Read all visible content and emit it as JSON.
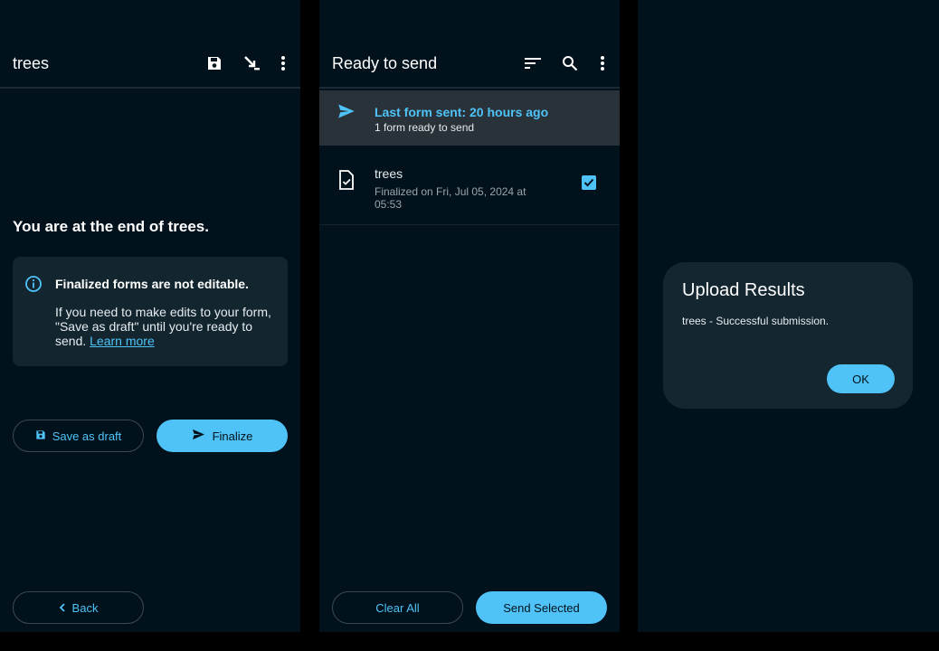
{
  "panel1": {
    "title": "trees",
    "toolbar_icons": [
      "save-icon",
      "jump-icon",
      "more-vert-icon"
    ],
    "end_message": "You are at the end of trees.",
    "info_card": {
      "heading": "Finalized forms are not editable.",
      "body": "If you need to make edits to your form, \"Save as draft\" until you're ready to send.",
      "link": "Learn more"
    },
    "save_draft_label": "Save as draft",
    "finalize_label": "Finalize",
    "back_label": "Back"
  },
  "panel2": {
    "title": "Ready to send",
    "toolbar_icons": [
      "sort-icon",
      "search-icon",
      "more-vert-icon"
    ],
    "banner": {
      "title": "Last form sent: 20 hours ago",
      "subtitle": "1 form ready to send"
    },
    "forms": [
      {
        "name": "trees",
        "status": "Finalized on Fri, Jul 05, 2024 at 05:53",
        "checked": true
      }
    ],
    "clear_all_label": "Clear All",
    "send_selected_label": "Send Selected"
  },
  "panel3": {
    "dialog": {
      "title": "Upload Results",
      "message": "trees - Successful submission.",
      "ok_label": "OK"
    }
  },
  "colors": {
    "background": "#02121c",
    "accent": "#4fc3f7",
    "card": "#132630",
    "banner": "#283238"
  }
}
